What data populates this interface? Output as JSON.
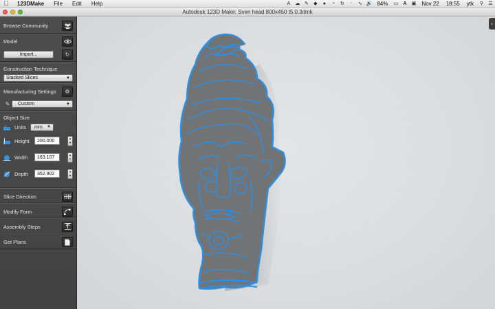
{
  "menubar": {
    "app_name": "123DMake",
    "menus": [
      "File",
      "Edit",
      "Help"
    ],
    "battery": "84%",
    "date": "Nov 22",
    "time": "18:55",
    "user": "ytk"
  },
  "window": {
    "title": "Autodesk 123D Make: Sven head 800x450 t5.0.3dmk"
  },
  "sidebar": {
    "browse_community": "Browse Community",
    "model": "Model",
    "import_label": "Import...",
    "construction_technique": "Construction Technique",
    "construction_value": "Stacked Slices",
    "manufacturing_settings": "Manufacturing Settings",
    "manufacturing_value": "Custom",
    "object_size": "Object Size",
    "units_label": "Units",
    "units_value": "mm",
    "height_label": "Height",
    "height_value": "200.000",
    "width_label": "Width",
    "width_value": "163.107",
    "depth_label": "Depth",
    "depth_value": "352.902",
    "slice_direction": "Slice Direction",
    "modify_form": "Modify Form",
    "assembly_steps": "Assembly Steps",
    "get_plans": "Get Plans"
  },
  "colors": {
    "slice_blue": "#2f8fe0",
    "slice_gray": "#6f7072",
    "canvas_bg": "#dcdedf",
    "sidebar_bg": "#474747"
  },
  "icons": {
    "apple": "apple-icon",
    "community": "people-icon",
    "eye": "eye-icon",
    "refresh": "refresh-icon",
    "settings": "gear-icon",
    "pencil": "pencil-icon",
    "slice": "slice-direction-icon",
    "modify": "modify-form-icon",
    "assembly": "assembly-steps-icon",
    "plans": "document-icon"
  }
}
